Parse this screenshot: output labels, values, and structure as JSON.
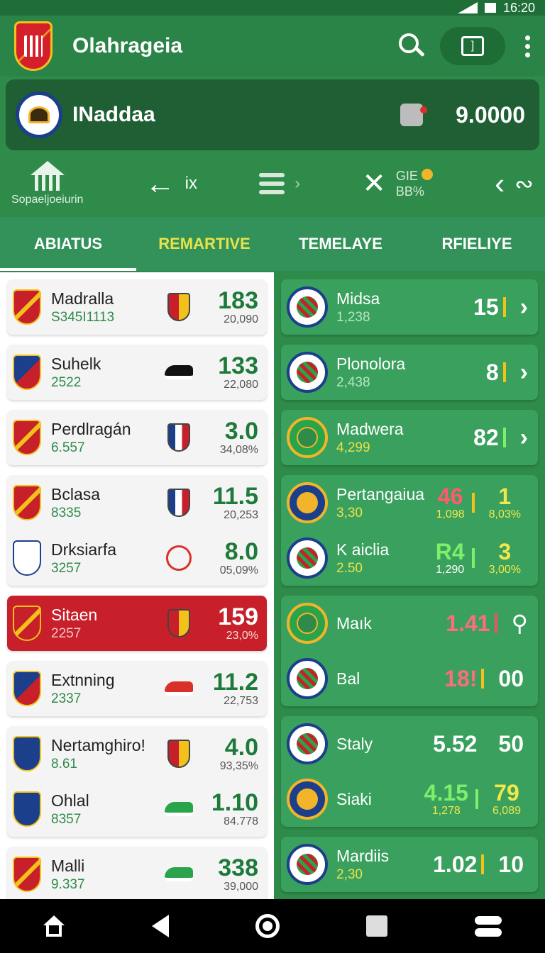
{
  "status": {
    "time": "16:20"
  },
  "app": {
    "title": "Olahrageia"
  },
  "account": {
    "name": "INaddaa",
    "balance": "9.0000"
  },
  "quicknav": {
    "home_label": "Sopaeljoeiurin",
    "back_label": "ix",
    "stat_top": "GIE",
    "stat_bottom": "BB%"
  },
  "tabs": [
    "ABIATUS",
    "REMARTIVE",
    "TEMELAYE",
    "RFIELIYE"
  ],
  "left_cards": [
    {
      "rows": [
        {
          "name": "Madralla",
          "sub": "S345I1113",
          "big": "183",
          "small": "20,090",
          "icon": "mini-shield"
        }
      ]
    },
    {
      "rows": [
        {
          "name": "Suhelk",
          "sub": "2522",
          "big": "133",
          "small": "22,080",
          "icon": "shoe"
        }
      ]
    },
    {
      "rows": [
        {
          "name": "Perdlragán",
          "sub": "6.557",
          "big": "3.0",
          "small": "34,08%",
          "icon": "mini-shield-alt"
        }
      ]
    },
    {
      "rows": [
        {
          "name": "Bclasa",
          "sub": "8335",
          "big": "11.5",
          "small": "20,253",
          "icon": "mini-shield-alt"
        },
        {
          "name": "Drksiarfa",
          "sub": "3257",
          "big": "8.0",
          "small": "05,09%",
          "icon": "circle-logo"
        }
      ]
    },
    {
      "rows": [
        {
          "name": "Sitaen",
          "sub": "2257",
          "big": "159",
          "small": "23,0%",
          "icon": "mini-shield"
        }
      ],
      "highlight": true
    },
    {
      "rows": [
        {
          "name": "Extnning",
          "sub": "2337",
          "big": "11.2",
          "small": "22,753",
          "icon": "shoe-red"
        }
      ]
    },
    {
      "rows": [
        {
          "name": "Nertamghiro!",
          "sub": "8.61",
          "big": "4.0",
          "small": "93,35%",
          "icon": "mini-shield"
        },
        {
          "name": "Ohlal",
          "sub": "8357",
          "big": "1.10",
          "small": "84.778",
          "icon": "shoe-green"
        }
      ]
    },
    {
      "rows": [
        {
          "name": "Malli",
          "sub": "9.337",
          "big": "338",
          "small": "39,000",
          "icon": "shoe-green"
        }
      ]
    }
  ],
  "right_cards": [
    {
      "name": "Midsa",
      "sub": "1,238",
      "val": "15"
    },
    {
      "name": "Plonolora",
      "sub": "2,438",
      "val": "8"
    },
    {
      "name": "Madwera",
      "sub": "4,299",
      "val": "82"
    },
    {
      "name": "Pertangaiua",
      "sub": "3,30",
      "v1": "46",
      "s1": "1,098",
      "v2": "1",
      "s2": "8,03%"
    },
    {
      "name": "K aiclia",
      "sub": "2.50",
      "v1": "R4",
      "s1": "1,290",
      "v2": "3",
      "s2": "3,00%"
    },
    {
      "name": "Maık",
      "val": "1.41"
    },
    {
      "name": "Bal",
      "val": "18!",
      "val2": "00"
    },
    {
      "name": "Staly",
      "val": "5.52",
      "val2": "50"
    },
    {
      "name": "Siaki",
      "v1": "4.15",
      "s1": "1,278",
      "v2": "79",
      "s2": "6,089"
    },
    {
      "name": "Mardiis",
      "sub": "2,30",
      "val": "1.02",
      "val2": "10"
    }
  ],
  "colors": {
    "primary": "#2e8b4a",
    "accent_red": "#c8202a",
    "accent_yellow": "#e8e24a"
  }
}
